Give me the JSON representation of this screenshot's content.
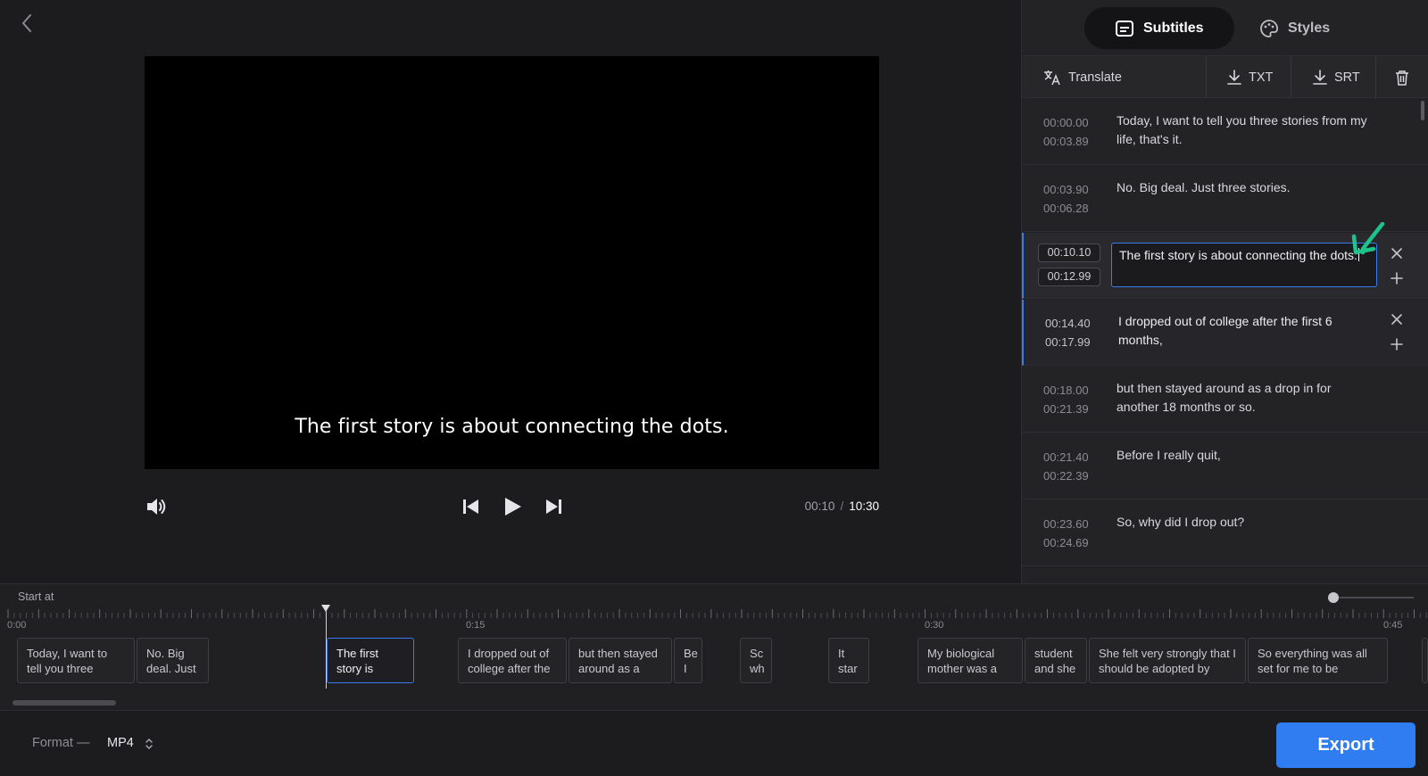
{
  "main": {
    "caption": "The first story is about connecting the dots.",
    "time_current": "00:10",
    "time_separator": "/",
    "time_total": "10:30"
  },
  "panel": {
    "tabs": [
      {
        "label": "Subtitles",
        "icon": "subtitles-icon",
        "active": true
      },
      {
        "label": "Styles",
        "icon": "palette-icon",
        "active": false
      }
    ],
    "toolbar": {
      "translate": "Translate",
      "txt": "TXT",
      "srt": "SRT"
    },
    "subtitles": [
      {
        "start": "00:00.00",
        "end": "00:03.89",
        "text": "Today, I want to tell you three stories from my life, that's it."
      },
      {
        "start": "00:03.90",
        "end": "00:06.28",
        "text": "No. Big deal. Just three stories."
      },
      {
        "start": "00:10.10",
        "end": "00:12.99",
        "text": "The first story is about connecting the dots.",
        "editing": true
      },
      {
        "start": "00:14.40",
        "end": "00:17.99",
        "text": "I dropped out of college after the first 6 months,"
      },
      {
        "start": "00:18.00",
        "end": "00:21.39",
        "text": "but then stayed around as a drop in for another 18 months or so."
      },
      {
        "start": "00:21.40",
        "end": "00:22.39",
        "text": "Before I really quit,"
      },
      {
        "start": "00:23.60",
        "end": "00:24.69",
        "text": "So, why did I drop out?"
      }
    ],
    "accent_color": "#3a7bf0",
    "check_color": "#1fc28a"
  },
  "timeline": {
    "start_label": "Start at",
    "ticks": [
      "0:00",
      "0:15",
      "0:30",
      "0:45"
    ],
    "clips": [
      {
        "text": "Today, I want to tell you three"
      },
      {
        "text": "No. Big deal. Just"
      },
      {
        "text": "The first story is",
        "selected": true
      },
      {
        "text": "I dropped out of college after the"
      },
      {
        "text": "but then stayed around as a"
      },
      {
        "text": "Be I"
      },
      {
        "text": "Sc wh"
      },
      {
        "text": "It star"
      },
      {
        "text": "My biological mother was a"
      },
      {
        "text": "student and she"
      },
      {
        "text": "She felt very strongly that I should be adopted by"
      },
      {
        "text": "So everything was all set for me to be"
      }
    ]
  },
  "bottom": {
    "format_label": "Format —",
    "format_value": "MP4",
    "export_label": "Export"
  }
}
